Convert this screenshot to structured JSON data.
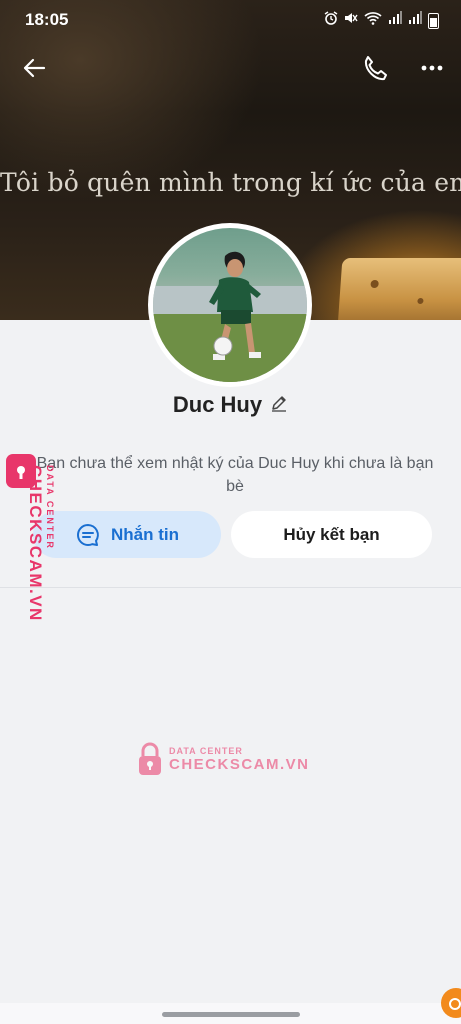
{
  "status_bar": {
    "time": "18:05"
  },
  "cover": {
    "quote": "Tôi bỏ quên mình trong kí ức của em"
  },
  "profile": {
    "name": "Duc Huy",
    "notice": "Bạn chưa thể xem nhật ký của Duc Huy khi chưa là bạn bè"
  },
  "actions": {
    "message_label": "Nhắn tin",
    "unfriend_label": "Hủy kết bạn"
  },
  "watermark": {
    "sub": "DATA CENTER",
    "brand": "CHECKSCAM.VN"
  },
  "icons": {
    "back": "arrow-left-icon",
    "call": "phone-icon",
    "more": "more-horizontal-icon",
    "edit": "pencil-icon",
    "chat": "chat-bubble-icon"
  },
  "colors": {
    "accent": "#1a6fd1",
    "message_button_bg": "#d7e8fb",
    "watermark": "#e8366a"
  }
}
